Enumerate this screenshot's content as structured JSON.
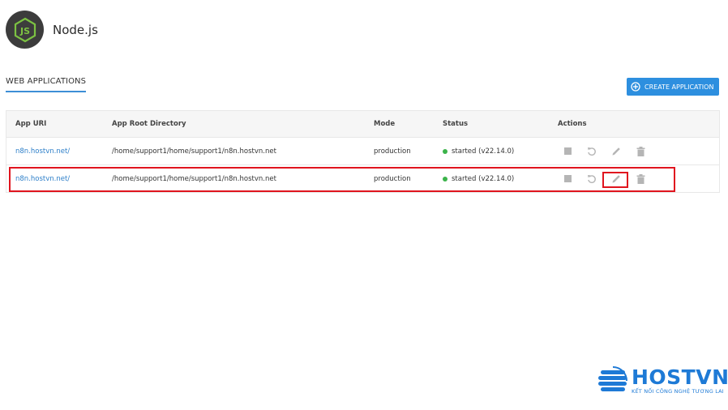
{
  "header": {
    "title": "Node.js",
    "logo_icon": "nodejs-js-hexagon-icon"
  },
  "tabs": [
    {
      "label": "WEB APPLICATIONS",
      "active": true
    }
  ],
  "toolbar": {
    "create_label": "CREATE APPLICATION",
    "create_icon": "plus-circle-icon"
  },
  "table": {
    "columns": [
      "App URI",
      "App Root Directory",
      "Mode",
      "Status",
      "Actions"
    ],
    "rows": [
      {
        "uri": "n8n.hostvn.net/",
        "root": "/home/support1/home/support1/n8n.hostvn.net",
        "mode": "production",
        "status": "started (v22.14.0)"
      },
      {
        "uri": "n8n.hostvn.net/",
        "root": "/home/support1/home/support1/n8n.hostvn.net",
        "mode": "production",
        "status": "started (v22.14.0)"
      }
    ],
    "action_icons": [
      "stop-icon",
      "restart-icon",
      "edit-pencil-icon",
      "trash-icon"
    ]
  },
  "brand": {
    "name": "HOSTVN",
    "slogan": "KẾT NỐI CÔNG NGHỆ TƯƠNG LAI"
  },
  "colors": {
    "accent": "#2d8fdf",
    "link": "#2d7fc9",
    "status_ok": "#3bb34a",
    "highlight": "#e0141e"
  }
}
